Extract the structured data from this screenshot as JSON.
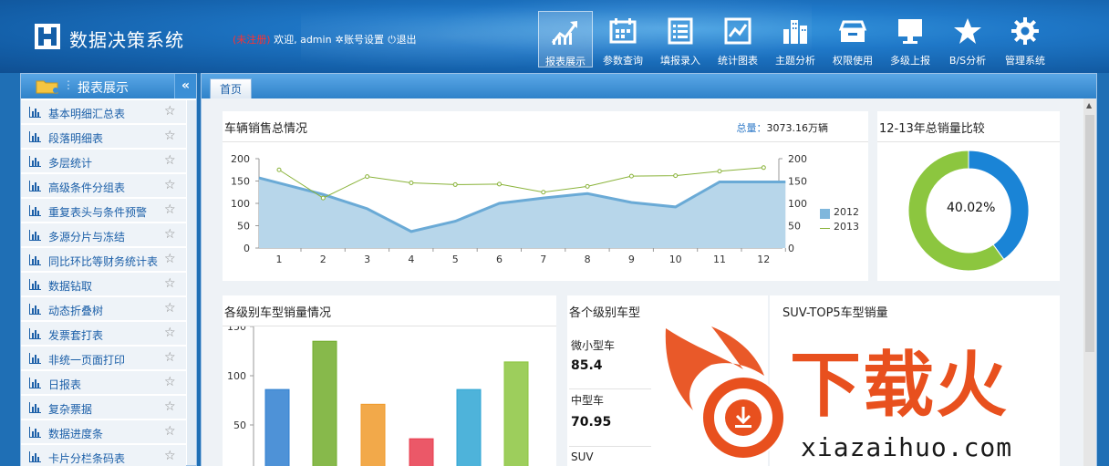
{
  "app": {
    "title": "数据决策系统",
    "unregistered": "(未注册)",
    "welcome": "欢迎, admin",
    "account_settings": "账号设置",
    "logout": "退出"
  },
  "topnav": [
    {
      "label": "报表展示",
      "icon": "chart-trend-icon",
      "active": true
    },
    {
      "label": "参数查询",
      "icon": "calendar-icon",
      "active": false
    },
    {
      "label": "填报录入",
      "icon": "list-icon",
      "active": false
    },
    {
      "label": "统计图表",
      "icon": "line-chart-icon",
      "active": false
    },
    {
      "label": "主题分析",
      "icon": "buildings-icon",
      "active": false
    },
    {
      "label": "权限使用",
      "icon": "tray-icon",
      "active": false
    },
    {
      "label": "多级上报",
      "icon": "monitor-icon",
      "active": false
    },
    {
      "label": "B/S分析",
      "icon": "star-icon",
      "active": false
    },
    {
      "label": "管理系统",
      "icon": "gear-icon",
      "active": false
    }
  ],
  "sidebar": {
    "title": "报表展示",
    "collapse": "«",
    "items": [
      "基本明细汇总表",
      "段落明细表",
      "多层统计",
      "高级条件分组表",
      "重复表头与条件预警",
      "多源分片与冻结",
      "同比环比等财务统计表",
      "数据钻取",
      "动态折叠树",
      "发票套打表",
      "非统一页面打印",
      "日报表",
      "复杂票据",
      "数据进度条",
      "卡片分栏条码表"
    ]
  },
  "tabs": {
    "home": "首页"
  },
  "panels": {
    "sales": {
      "title": "车辆销售总情况",
      "total_key": "总量：",
      "total_value": "3073.16万辆"
    },
    "compare": {
      "title": "12-13年总销量比较",
      "center": "40.02%"
    },
    "level_sales": {
      "title": "各级别车型销量情况"
    },
    "levels": {
      "title": "各个级别车型",
      "items": [
        {
          "name": "微小型车",
          "value": "85.4"
        },
        {
          "name": "中型车",
          "value": "70.95"
        },
        {
          "name": "SUV",
          "value": ""
        }
      ]
    },
    "suv": {
      "title": "SUV-TOP5车型销量"
    }
  },
  "chart_data": [
    {
      "type": "area",
      "x": [
        "1",
        "2",
        "3",
        "4",
        "5",
        "6",
        "7",
        "8",
        "9",
        "10",
        "11",
        "12"
      ],
      "ylim": [
        0,
        200
      ],
      "yticks": [
        "0",
        "50",
        "100",
        "150",
        "200"
      ],
      "series": [
        {
          "name": "2012",
          "values": [
            157,
            120,
            88,
            37,
            60,
            100,
            112,
            122,
            102,
            92,
            148,
            148
          ],
          "color": "#7fb7dc"
        },
        {
          "name": "2013",
          "values": [
            175,
            112,
            160,
            146,
            142,
            143,
            125,
            138,
            161,
            162,
            172,
            180
          ],
          "color": "#8ab33a"
        }
      ]
    },
    {
      "type": "pie",
      "values": [
        40.02,
        59.98
      ],
      "colors": [
        "#1a84d6",
        "#8cc63f"
      ]
    },
    {
      "type": "bar",
      "ylim": [
        0,
        150
      ],
      "yticks": [
        "50",
        "100",
        "150"
      ],
      "values": [
        86,
        135,
        71,
        36,
        86,
        114
      ],
      "colors": [
        "#2f7fd0",
        "#72ad2c",
        "#f09a2a",
        "#e83b4d",
        "#2fa6d4",
        "#8cc63f"
      ]
    }
  ],
  "watermark": {
    "brand": "下载火",
    "domain": "xiazaihuo.com"
  }
}
